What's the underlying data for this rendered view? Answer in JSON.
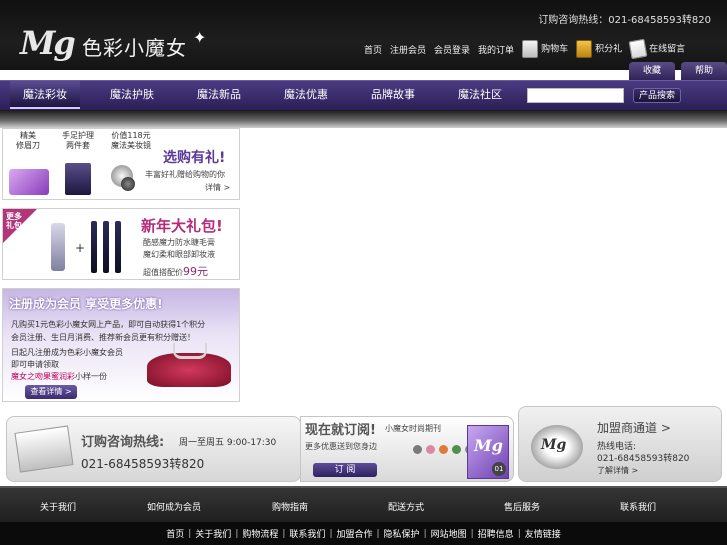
{
  "header": {
    "logo_mark": "Mg",
    "brand_name": "色彩小魔女",
    "hotline": "订购咨询热线：021-68458593转820",
    "top_links": [
      "首页",
      "注册会员",
      "会员登录",
      "我的订单"
    ],
    "icon_links": [
      {
        "label": "购物车",
        "icon": "shopping-bag-icon"
      },
      {
        "label": "积分礼",
        "icon": "gift-icon"
      },
      {
        "label": "在线留言",
        "icon": "note-icon"
      }
    ],
    "util_tabs": [
      "收藏",
      "帮助"
    ]
  },
  "nav": {
    "items": [
      "魔法彩妆",
      "魔法护肤",
      "魔法新品",
      "魔法优惠",
      "品牌故事",
      "魔法社区"
    ],
    "active_index": 0,
    "search_placeholder": "",
    "search_button": "产品搜索"
  },
  "promo_gift": {
    "items": [
      "精美\n修眉刀",
      "手足护理\n两件套",
      "价值118元\n魔法美妆镜"
    ],
    "title": "选购有礼!",
    "subtitle": "丰富好礼赠给购物的你",
    "more": "详情 >"
  },
  "promo_newyear": {
    "corner": "更多\n礼包",
    "title": "新年大礼包!",
    "lines": [
      "酷感魔力防水睫毛膏",
      "魔幻柔和眼部卸妆液"
    ],
    "price_label": "超值搭配价",
    "price_value": "99元"
  },
  "promo_register": {
    "title": "注册成为会员 享受更多优惠!",
    "lines": [
      "凡购买1元色彩小魔女网上产品，即可自动获得1个积分",
      "会员注册、生日月消费、推荐新会员更有积分赠送！",
      "日起凡注册成为色彩小魔女会员",
      "即可申请领取"
    ],
    "highlight": "魔女之吻果蜜润彩",
    "highlight_suffix": "小样一份",
    "button": "查看详情 >"
  },
  "hotline_box": {
    "title": "订购咨询热线:",
    "hours": "周一至周五 9:00-17:30",
    "phone": "021-68458593转820"
  },
  "subscribe_box": {
    "title": "现在就订阅!",
    "small": "小魔女时尚期刊",
    "text": "更多优惠送到您身边",
    "button": "订 阅",
    "magazine_logo": "Mg",
    "issue": "01",
    "dot_colors": [
      "#7a7a7a",
      "#d98aa0",
      "#e07a3a",
      "#4d8f4d",
      "#8a8a8a",
      "#5577aa"
    ]
  },
  "join_box": {
    "logo": "Mg",
    "title": "加盟商通道 >",
    "phone_label": "热线电话:",
    "phone": "021-68458593转820",
    "more": "了解详情 >"
  },
  "bottom_nav": [
    "关于我们",
    "如何成为会员",
    "购物指南",
    "配送方式",
    "售后服务",
    "联系我们"
  ],
  "bottom_links": [
    "首页",
    "关于我们",
    "购物流程",
    "联系我们",
    "加盟合作",
    "隐私保护",
    "网站地图",
    "招聘信息",
    "友情链接"
  ],
  "colors": {
    "nav_purple": "#3b2d6e",
    "brand_magenta": "#b32d7a",
    "title_purple": "#5b3b98"
  }
}
